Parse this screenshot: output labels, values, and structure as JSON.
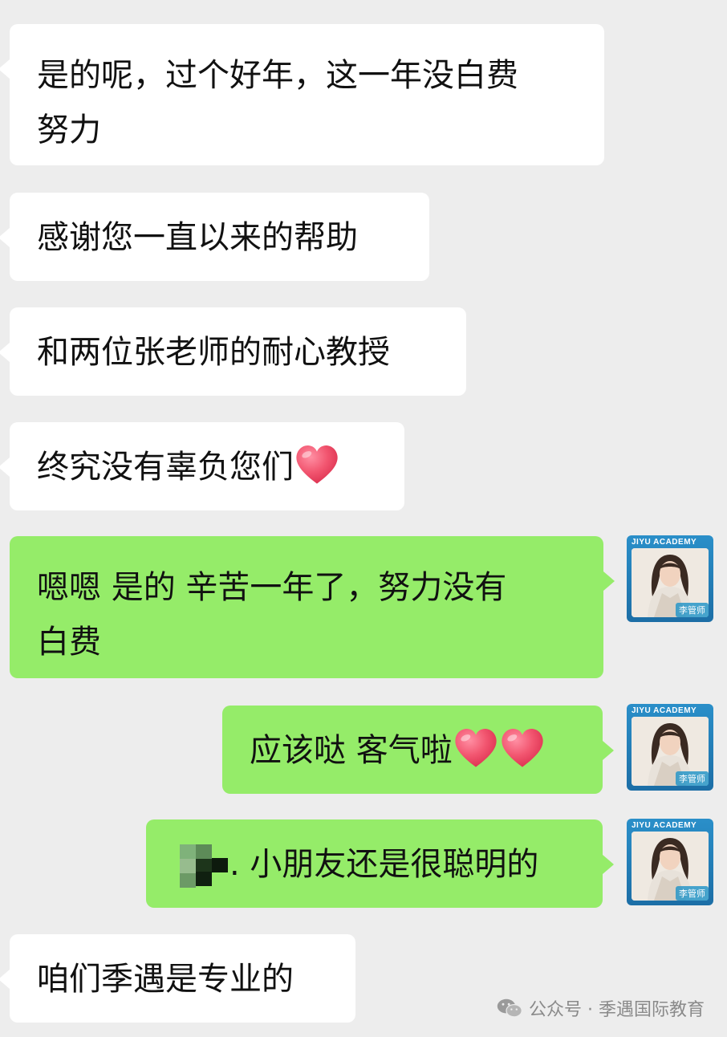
{
  "messages": [
    {
      "id": 1,
      "side": "incoming",
      "lines": [
        "是的呢，过个好年，这一年没白费",
        "努力"
      ]
    },
    {
      "id": 2,
      "side": "incoming",
      "text": "感谢您一直以来的帮助"
    },
    {
      "id": 3,
      "side": "incoming",
      "text": "和两位张老师的耐心教授"
    },
    {
      "id": 4,
      "side": "incoming",
      "text": "终究没有辜负您们",
      "emoji": [
        "heart-icon"
      ]
    },
    {
      "id": 5,
      "side": "outgoing",
      "lines": [
        "嗯嗯 是的 辛苦一年了，努力没有",
        "白费"
      ]
    },
    {
      "id": 6,
      "side": "outgoing",
      "text": "应该哒 客气啦",
      "emoji": [
        "heart-icon",
        "heart-icon"
      ]
    },
    {
      "id": 7,
      "side": "outgoing",
      "text": ". 小朋友还是很聪明的",
      "redacted_name": true
    },
    {
      "id": 8,
      "side": "incoming",
      "text": "咱们季遇是专业的"
    }
  ],
  "avatar": {
    "brand": "JIYU ACADEMY",
    "tag": "李管师"
  },
  "watermark": {
    "text": "公众号 · 季遇国际教育",
    "icon": "wechat-icon"
  },
  "colors": {
    "background": "#ededed",
    "incoming_bubble": "#ffffff",
    "outgoing_bubble": "#95ec69",
    "heart": "#f0455f"
  }
}
